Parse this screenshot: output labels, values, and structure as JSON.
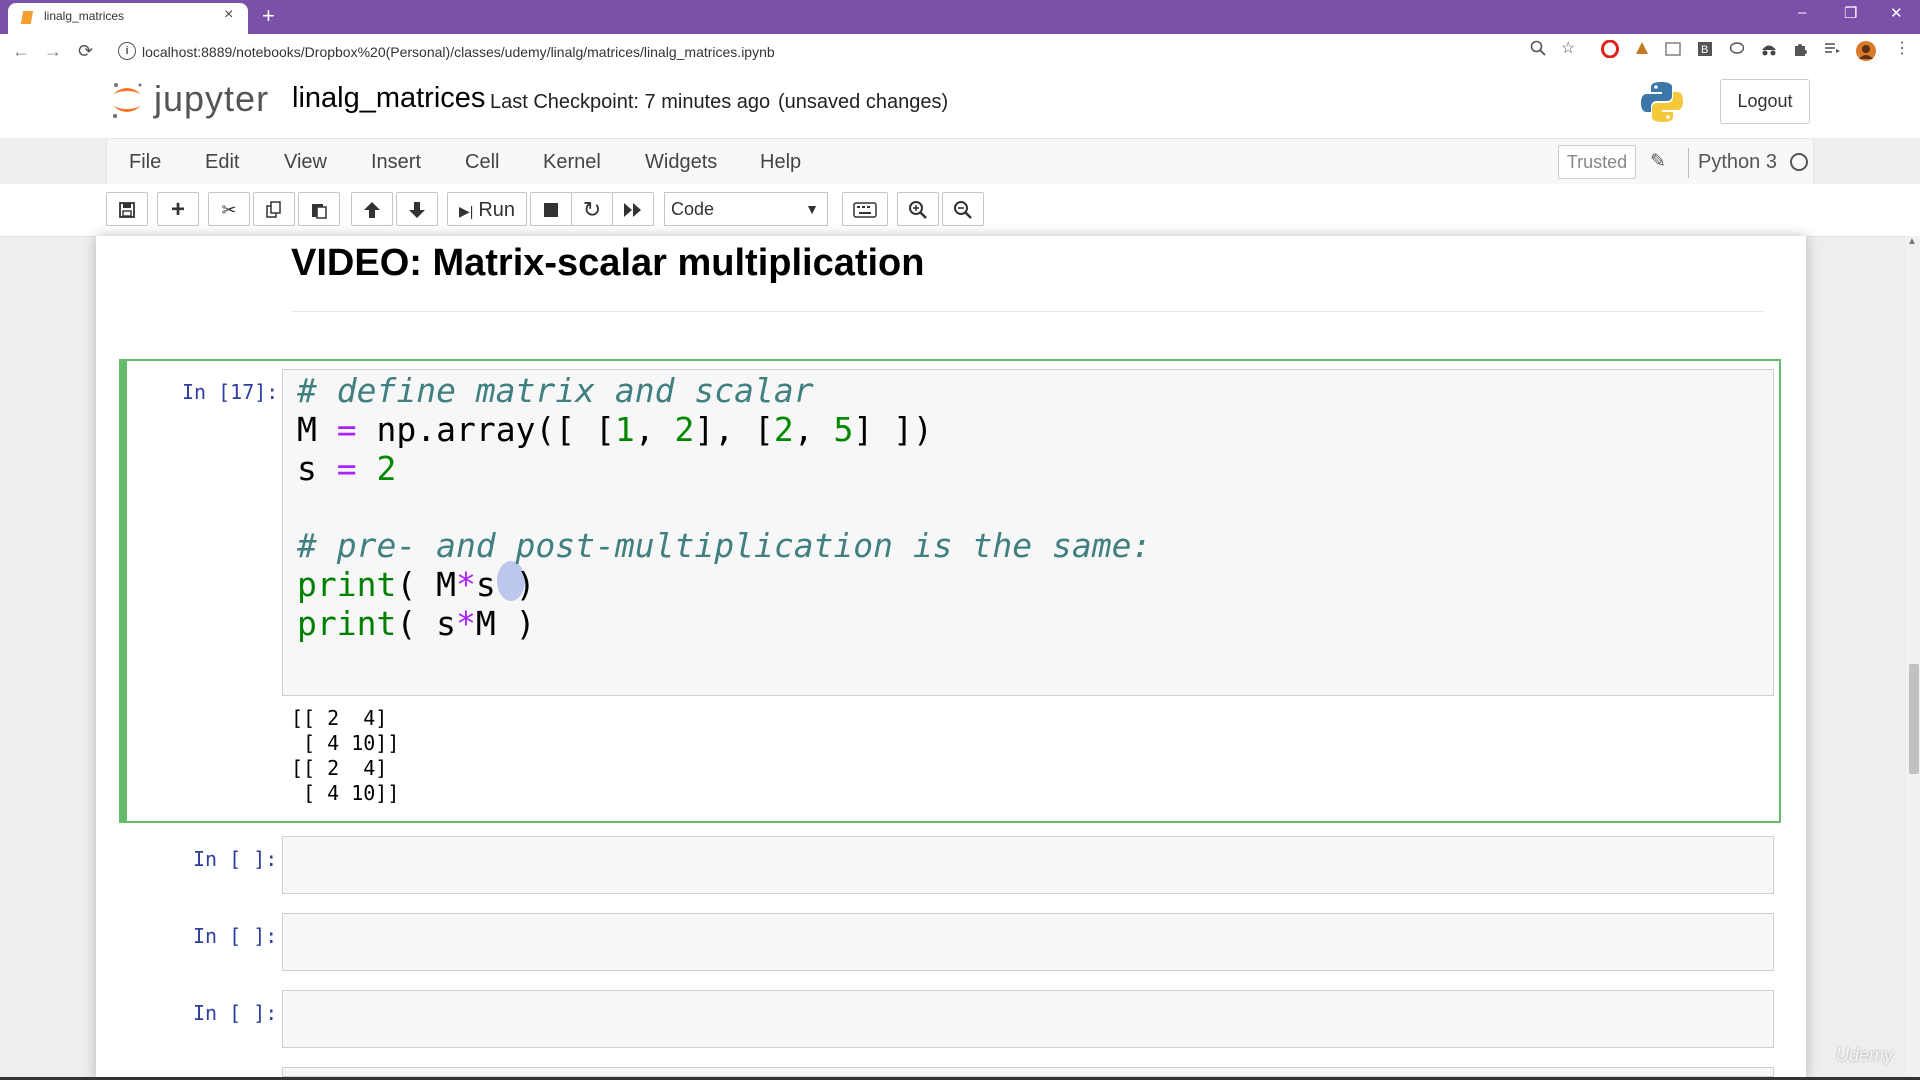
{
  "browser": {
    "tab_title": "linalg_matrices",
    "tab_close": "×",
    "new_tab": "+",
    "window_controls": [
      "–",
      "❐",
      "✕"
    ],
    "nav": [
      "←",
      "→",
      "⟳"
    ],
    "url": "localhost:8889/notebooks/Dropbox%20(Personal)/classes/udemy/linalg/matrices/linalg_matrices.ipynb",
    "info_icon": "i",
    "extension_icons": [
      "zoom-icon",
      "star-icon",
      "opera-icon",
      "ext-icon",
      "window-icon",
      "b-icon",
      "chat-icon",
      "incognito-icon",
      "puzzle-icon",
      "playlist-icon",
      "avatar-icon",
      "menu-icon"
    ]
  },
  "header": {
    "logo_text": "jupyter",
    "notebook_name": "linalg_matrices",
    "checkpoint": "Last Checkpoint: 7 minutes ago",
    "unsaved": "(unsaved changes)",
    "logout_label": "Logout"
  },
  "menubar": {
    "items": [
      "File",
      "Edit",
      "View",
      "Insert",
      "Cell",
      "Kernel",
      "Widgets",
      "Help"
    ],
    "trusted": "Trusted",
    "kernel": "Python 3"
  },
  "toolbar": {
    "run_label": "Run",
    "cell_type": "Code"
  },
  "notebook": {
    "heading": "VIDEO: Matrix-scalar multiplication",
    "cells": [
      {
        "prompt": "In [17]:",
        "code": [
          "# define matrix and scalar",
          "M = np.array([ [1, 2], [2, 5] ])",
          "s = 2",
          "",
          "# pre- and post-multiplication is the same:",
          "print( M*s )",
          "print( s*M )"
        ],
        "output": [
          "[[ 2  4]",
          " [ 4 10]]",
          "[[ 2  4]",
          " [ 4 10]]"
        ]
      },
      {
        "prompt": "In [ ]:"
      },
      {
        "prompt": "In [ ]:"
      },
      {
        "prompt": "In [ ]:"
      }
    ]
  },
  "watermark": "Udemy",
  "colors": {
    "tabbar": "#7a50a8",
    "selected_cell": "#66bb6a",
    "prompt": "#303f9f",
    "comment": "#408080",
    "keyword": "#008000",
    "operator": "#aa22ff"
  }
}
